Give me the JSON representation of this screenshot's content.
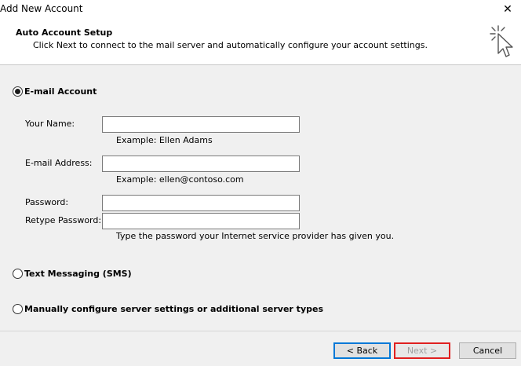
{
  "window": {
    "title": "Add New Account",
    "close_glyph": "✕"
  },
  "header": {
    "title": "Auto Account Setup",
    "subtitle": "Click Next to connect to the mail server and automatically configure your account settings.",
    "icon": "wizard-cursor-icon"
  },
  "options": {
    "email": {
      "label": "E-mail Account",
      "selected": true
    },
    "sms": {
      "label": "Text Messaging (SMS)",
      "selected": false
    },
    "manual": {
      "label": "Manually configure server settings or additional server types",
      "selected": false
    }
  },
  "fields": {
    "name": {
      "label": "Your Name:",
      "value": "",
      "hint": "Example: Ellen Adams"
    },
    "email": {
      "label": "E-mail Address:",
      "value": "",
      "hint": "Example: ellen@contoso.com"
    },
    "password": {
      "label": "Password:",
      "value": ""
    },
    "retype": {
      "label": "Retype Password:",
      "value": "",
      "hint": "Type the password your Internet service provider has given you."
    }
  },
  "buttons": {
    "back": "< Back",
    "next": "Next >",
    "cancel": "Cancel"
  },
  "colors": {
    "accent": "#0078d7",
    "highlight": "#e02020"
  }
}
